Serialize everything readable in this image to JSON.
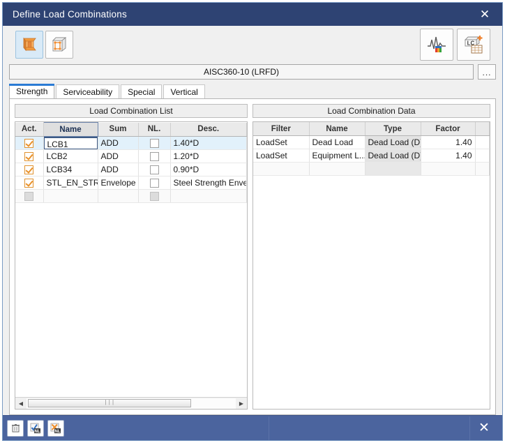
{
  "window": {
    "title": "Define Load Combinations",
    "close_label": "✕"
  },
  "toolbar": {
    "left_buttons": [
      {
        "name": "steel-section-icon",
        "label": "",
        "active": true
      },
      {
        "name": "concrete-solid-icon",
        "label": "",
        "active": false
      }
    ],
    "right_buttons": [
      {
        "name": "seismic-response-icon",
        "label": ""
      },
      {
        "name": "add-load-combination-table-icon",
        "label": ""
      }
    ]
  },
  "design_code": {
    "value": "AISC360-10 (LRFD)",
    "browse_label": "..."
  },
  "tabs": [
    {
      "label": "Strength",
      "active": true
    },
    {
      "label": "Serviceability",
      "active": false
    },
    {
      "label": "Special",
      "active": false
    },
    {
      "label": "Vertical",
      "active": false
    }
  ],
  "left_panel": {
    "header": "Load Combination List",
    "columns": [
      "Act.",
      "Name",
      "Sum",
      "NL.",
      "Desc."
    ],
    "selected_column": "Name",
    "rows": [
      {
        "act": true,
        "name": "LCB1",
        "sum": "ADD",
        "nl": false,
        "desc": "1.40*D",
        "selected": true,
        "editing": true
      },
      {
        "act": true,
        "name": "LCB2",
        "sum": "ADD",
        "nl": false,
        "desc": "1.20*D",
        "selected": false,
        "editing": false
      },
      {
        "act": true,
        "name": "LCB34",
        "sum": "ADD",
        "nl": false,
        "desc": "0.90*D",
        "selected": false,
        "editing": false
      },
      {
        "act": true,
        "name": "STL_EN_STR",
        "sum": "Envelope",
        "nl": false,
        "desc": "Steel Strength Envelop",
        "selected": false,
        "editing": false
      }
    ],
    "blank_row": {
      "act": "disabled",
      "nl": "disabled"
    },
    "scrollbar": {
      "left_arrow": "◀",
      "right_arrow": "▶",
      "grip": "⫴"
    }
  },
  "right_panel": {
    "header": "Load Combination Data",
    "columns": [
      "Filter",
      "Name",
      "Type",
      "Factor"
    ],
    "rows": [
      {
        "filter": "LoadSet",
        "name": "Dead Load",
        "type": "Dead Load (D)",
        "factor": "1.40"
      },
      {
        "filter": "LoadSet",
        "name": "Equipment L...",
        "type": "Dead Load (D)",
        "factor": "1.40"
      }
    ]
  },
  "footer": {
    "buttons": [
      {
        "name": "delete-row-button",
        "label": ""
      },
      {
        "name": "enable-nonlinear-button",
        "label": "NL"
      },
      {
        "name": "disable-nonlinear-button",
        "label": "NL"
      }
    ],
    "close_label": "✕"
  },
  "colors": {
    "title_bar": "#2e4373",
    "footer_bar": "#4b649e",
    "tab_accent": "#2a7bd4",
    "selection": "#e2f1fb",
    "checkmark": "#e8912a"
  }
}
